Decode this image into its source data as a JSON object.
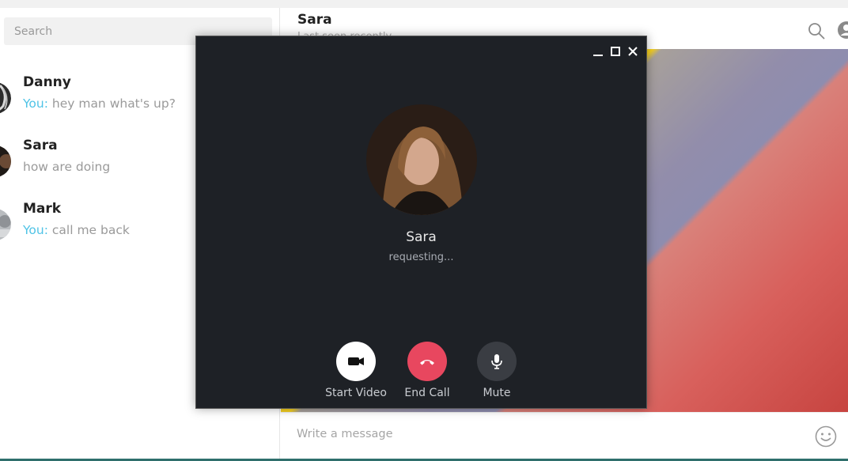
{
  "search": {
    "placeholder": "Search"
  },
  "chats": [
    {
      "name": "Danny",
      "you_prefix": "You:",
      "preview": " hey man what's up?"
    },
    {
      "name": "Sara",
      "you_prefix": "",
      "preview": "how are doing"
    },
    {
      "name": "Mark",
      "you_prefix": "You:",
      "preview": " call me back"
    }
  ],
  "chat_header": {
    "title": "Sara",
    "status": "Last seen recently"
  },
  "composer": {
    "placeholder": "Write a message"
  },
  "call": {
    "contact_name": "Sara",
    "status": "requesting...",
    "buttons": {
      "video_label": "Start Video",
      "end_label": "End Call",
      "mute_label": "Mute"
    }
  },
  "colors": {
    "accent_you": "#4fc3e6",
    "end_call": "#e8475f",
    "call_bg": "#1e2126"
  },
  "icons": [
    "search-icon",
    "profile-icon",
    "emoji-icon",
    "minimize-icon",
    "maximize-icon",
    "close-icon",
    "video-camera-icon",
    "phone-hangup-icon",
    "microphone-icon"
  ]
}
